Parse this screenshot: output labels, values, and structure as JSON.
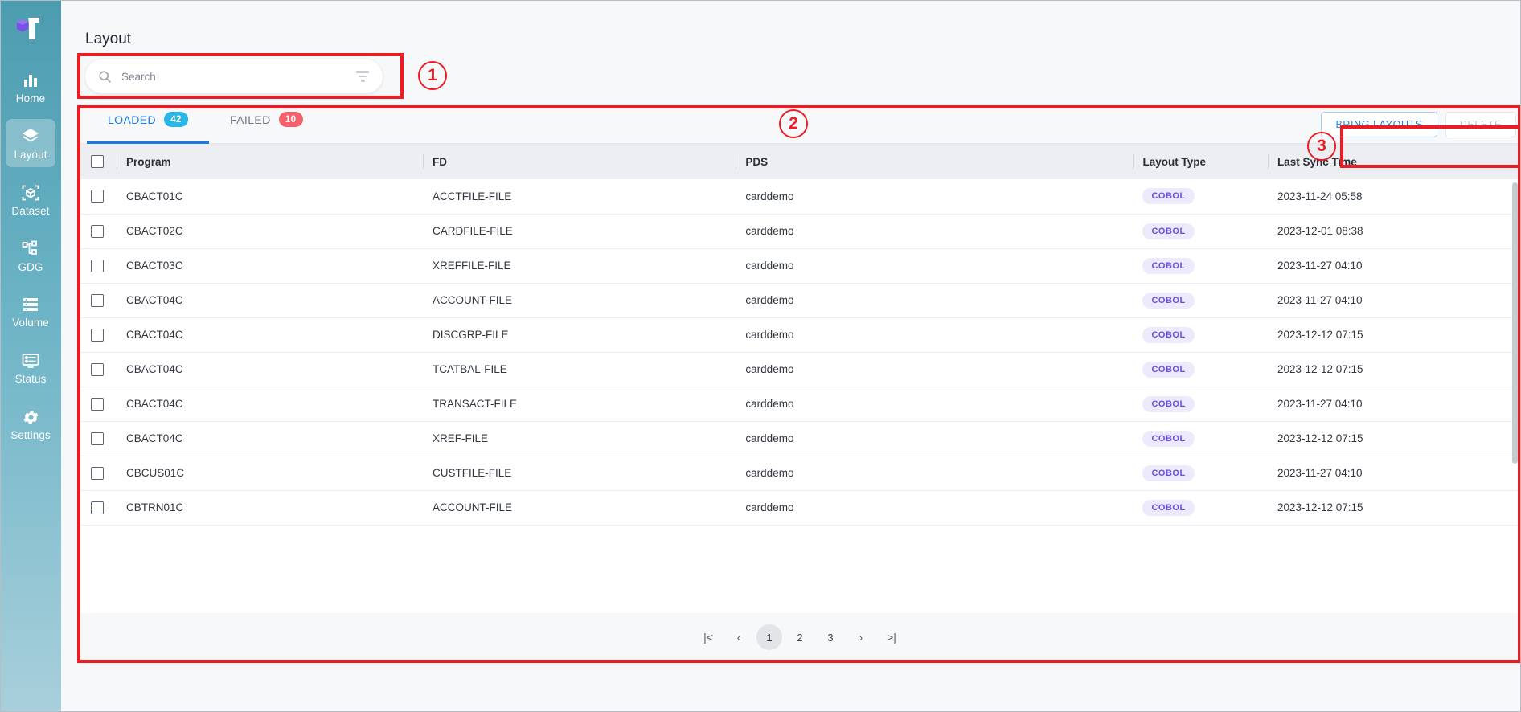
{
  "sidebar": {
    "logo_name": "brand-logo",
    "items": [
      {
        "id": "home",
        "label": "Home",
        "icon": "bar-chart-icon",
        "active": false
      },
      {
        "id": "layout",
        "label": "Layout",
        "icon": "layers-icon",
        "active": true
      },
      {
        "id": "dataset",
        "label": "Dataset",
        "icon": "cube-scan-icon",
        "active": false
      },
      {
        "id": "gdg",
        "label": "GDG",
        "icon": "sitemap-icon",
        "active": false
      },
      {
        "id": "volume",
        "label": "Volume",
        "icon": "storage-icon",
        "active": false
      },
      {
        "id": "status",
        "label": "Status",
        "icon": "monitor-list-icon",
        "active": false
      },
      {
        "id": "settings",
        "label": "Settings",
        "icon": "gear-icon",
        "active": false
      }
    ]
  },
  "header": {
    "title": "Layout"
  },
  "search": {
    "placeholder": "Search",
    "value": "",
    "search_icon": "search-icon",
    "filter_icon": "filter-icon"
  },
  "tabs": [
    {
      "id": "loaded",
      "label": "LOADED",
      "count": "42",
      "active": true,
      "badge_color": "#29b6e8"
    },
    {
      "id": "failed",
      "label": "FAILED",
      "count": "10",
      "active": false,
      "badge_color": "#f4606c"
    }
  ],
  "actions": {
    "bring_layouts_label": "BRING LAYOUTS",
    "delete_label": "DELETE",
    "primary_color": "#2f7fd4",
    "disabled_color": "#c3c6cc"
  },
  "table": {
    "columns": [
      "Program",
      "FD",
      "PDS",
      "Layout Type",
      "Last Sync Time"
    ],
    "rows": [
      {
        "program": "CBACT01C",
        "fd": "ACCTFILE-FILE",
        "pds": "carddemo",
        "type": "COBOL",
        "time": "2023-11-24 05:58"
      },
      {
        "program": "CBACT02C",
        "fd": "CARDFILE-FILE",
        "pds": "carddemo",
        "type": "COBOL",
        "time": "2023-12-01 08:38"
      },
      {
        "program": "CBACT03C",
        "fd": "XREFFILE-FILE",
        "pds": "carddemo",
        "type": "COBOL",
        "time": "2023-11-27 04:10"
      },
      {
        "program": "CBACT04C",
        "fd": "ACCOUNT-FILE",
        "pds": "carddemo",
        "type": "COBOL",
        "time": "2023-11-27 04:10"
      },
      {
        "program": "CBACT04C",
        "fd": "DISCGRP-FILE",
        "pds": "carddemo",
        "type": "COBOL",
        "time": "2023-12-12 07:15"
      },
      {
        "program": "CBACT04C",
        "fd": "TCATBAL-FILE",
        "pds": "carddemo",
        "type": "COBOL",
        "time": "2023-12-12 07:15"
      },
      {
        "program": "CBACT04C",
        "fd": "TRANSACT-FILE",
        "pds": "carddemo",
        "type": "COBOL",
        "time": "2023-11-27 04:10"
      },
      {
        "program": "CBACT04C",
        "fd": "XREF-FILE",
        "pds": "carddemo",
        "type": "COBOL",
        "time": "2023-12-12 07:15"
      },
      {
        "program": "CBCUS01C",
        "fd": "CUSTFILE-FILE",
        "pds": "carddemo",
        "type": "COBOL",
        "time": "2023-11-27 04:10"
      },
      {
        "program": "CBTRN01C",
        "fd": "ACCOUNT-FILE",
        "pds": "carddemo",
        "type": "COBOL",
        "time": "2023-12-12 07:15"
      }
    ],
    "badge_bg": "#eeeafd",
    "badge_fg": "#6b4ee6"
  },
  "pagination": {
    "first_label": "|<",
    "prev_label": "‹",
    "pages": [
      "1",
      "2",
      "3"
    ],
    "current_page": "1",
    "next_label": "›",
    "last_label": ">|"
  },
  "annotations": [
    {
      "id": "1",
      "label": "1"
    },
    {
      "id": "2",
      "label": "2"
    },
    {
      "id": "3",
      "label": "3"
    }
  ]
}
